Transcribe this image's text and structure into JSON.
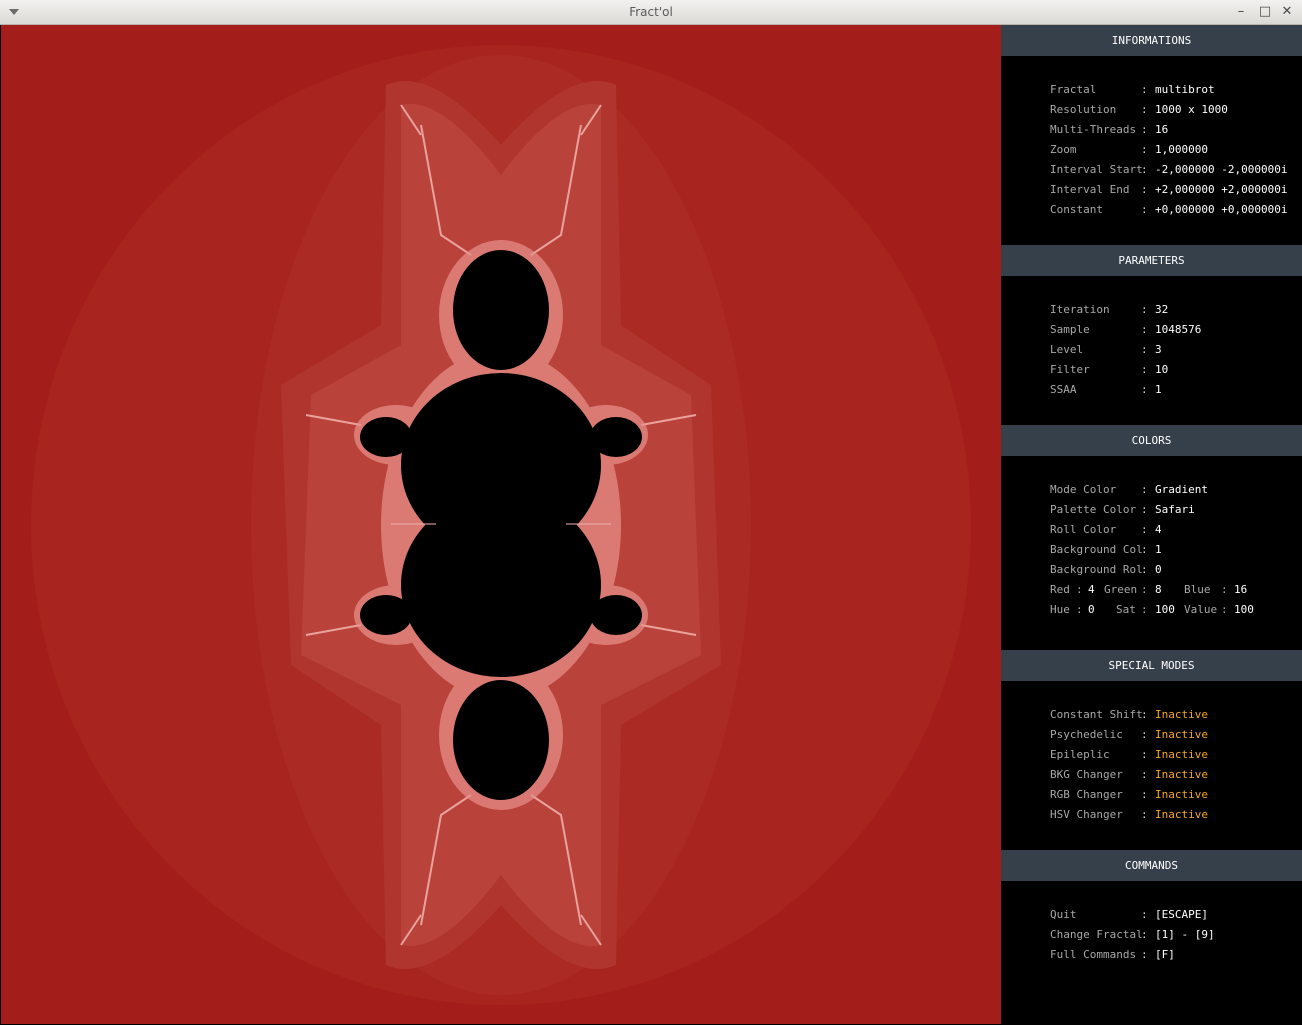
{
  "window": {
    "title": "Fract'ol",
    "minimize": "–",
    "maximize": "□",
    "close": "✕"
  },
  "fractal_view": {
    "background_color": "#a31e1a",
    "set_color": "#000000",
    "edge_color": "#ffd0cc"
  },
  "sections": {
    "informations": {
      "title": "INFORMATIONS",
      "rows": [
        {
          "label": "Fractal",
          "value": "multibrot"
        },
        {
          "label": "Resolution",
          "value": "1000 x 1000"
        },
        {
          "label": "Multi-Threads",
          "value": "16"
        },
        {
          "label": "Zoom",
          "value": "1,000000"
        },
        {
          "label": "Interval Start",
          "value": "-2,000000 -2,000000i"
        },
        {
          "label": "Interval End",
          "value": "+2,000000 +2,000000i"
        },
        {
          "label": "Constant",
          "value": "+0,000000 +0,000000i"
        }
      ]
    },
    "parameters": {
      "title": "PARAMETERS",
      "rows": [
        {
          "label": "Iteration",
          "value": "32"
        },
        {
          "label": "Sample",
          "value": "1048576"
        },
        {
          "label": "Level",
          "value": "3"
        },
        {
          "label": "Filter",
          "value": "10"
        },
        {
          "label": "SSAA",
          "value": "1"
        }
      ]
    },
    "colors": {
      "title": "COLORS",
      "rows": [
        {
          "label": "Mode Color",
          "value": "Gradient"
        },
        {
          "label": "Palette Color",
          "value": "Safari"
        },
        {
          "label": "Roll Color",
          "value": "4"
        },
        {
          "label": "Background Col",
          "value": "1"
        },
        {
          "label": "Background Rol",
          "value": "0"
        }
      ],
      "rgb": {
        "red_label": "Red",
        "red": "4",
        "green_label": "Green",
        "green": "8",
        "blue_label": "Blue",
        "blue": "16"
      },
      "hsv": {
        "hue_label": "Hue",
        "hue": "0",
        "sat_label": "Sat",
        "sat": "100",
        "value_label": "Value",
        "value": "100"
      }
    },
    "special_modes": {
      "title": "SPECIAL MODES",
      "status_color": "#f5a623",
      "rows": [
        {
          "label": "Constant Shift",
          "value": "Inactive"
        },
        {
          "label": "Psychedelic",
          "value": "Inactive"
        },
        {
          "label": "Epileplic",
          "value": "Inactive"
        },
        {
          "label": "BKG Changer",
          "value": "Inactive"
        },
        {
          "label": "RGB Changer",
          "value": "Inactive"
        },
        {
          "label": "HSV Changer",
          "value": "Inactive"
        }
      ]
    },
    "commands": {
      "title": "COMMANDS",
      "rows": [
        {
          "label": "Quit",
          "value": "[ESCAPE]"
        },
        {
          "label": "Change Fractal",
          "value": "[1] - [9]"
        },
        {
          "label": "Full Commands",
          "value": "[F]"
        }
      ]
    }
  },
  "separator": ":"
}
